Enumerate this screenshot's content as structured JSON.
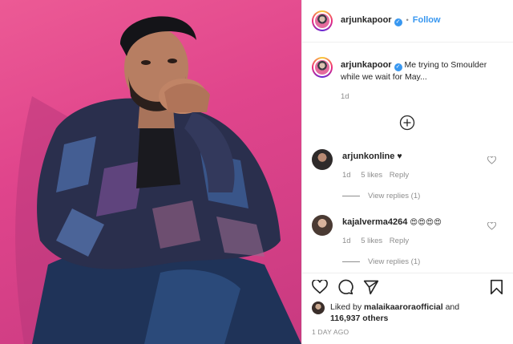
{
  "post": {
    "author": "arjunkapoor",
    "follow_label": "Follow",
    "separator": "•",
    "verified_glyph": "✓",
    "caption_text": "Me trying to Smoulder while we wait for May...",
    "caption_time": "1d",
    "load_more_icon": "plus-circle-icon"
  },
  "comments": [
    {
      "username": "arjunkonline",
      "text": "♥",
      "time": "1d",
      "likes": "5 likes",
      "reply": "Reply",
      "view_replies": "View replies (1)"
    },
    {
      "username": "kajalverma4264",
      "text": "😍😍😍😍",
      "time": "1d",
      "likes": "5 likes",
      "reply": "Reply",
      "view_replies": "View replies (1)"
    }
  ],
  "footer": {
    "liked_by_prefix": "Liked by",
    "liked_by_user": "malaikaaroraofficial",
    "liked_by_and": "and",
    "others_count": "116,937 others",
    "timestamp": "1 DAY AGO"
  },
  "colors": {
    "photo_background": "#e0458c",
    "link_blue": "#3897f0",
    "text_primary": "#262626",
    "text_muted": "#8e8e8e"
  }
}
